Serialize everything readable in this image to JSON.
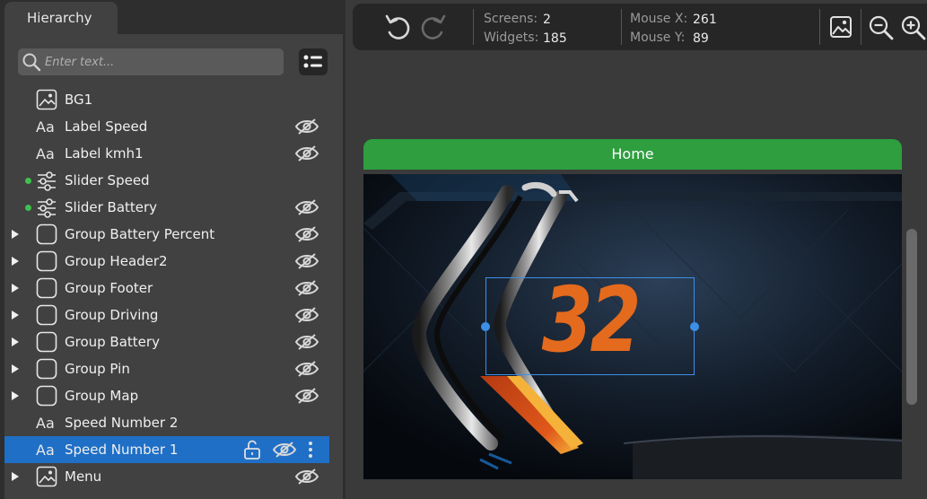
{
  "panel": {
    "tab_label": "Hierarchy",
    "search_placeholder": "Enter text..."
  },
  "tree": [
    {
      "label": "BG1",
      "icon": "image-icon",
      "expandable": false,
      "dot": false,
      "hidden_icon": false
    },
    {
      "label": "Label Speed",
      "icon": "text-icon",
      "expandable": false,
      "dot": false,
      "hidden_icon": true
    },
    {
      "label": "Label kmh1",
      "icon": "text-icon",
      "expandable": false,
      "dot": false,
      "hidden_icon": true
    },
    {
      "label": "Slider Speed",
      "icon": "slider-icon",
      "expandable": false,
      "dot": true,
      "hidden_icon": false
    },
    {
      "label": "Slider Battery",
      "icon": "slider-icon",
      "expandable": false,
      "dot": true,
      "hidden_icon": true
    },
    {
      "label": "Group Battery Percent",
      "icon": "group-icon",
      "expandable": true,
      "dot": false,
      "hidden_icon": true
    },
    {
      "label": "Group Header2",
      "icon": "group-icon",
      "expandable": true,
      "dot": false,
      "hidden_icon": true
    },
    {
      "label": "Group Footer",
      "icon": "group-icon",
      "expandable": true,
      "dot": false,
      "hidden_icon": true
    },
    {
      "label": "Group Driving",
      "icon": "group-icon",
      "expandable": true,
      "dot": false,
      "hidden_icon": true
    },
    {
      "label": "Group Battery",
      "icon": "group-icon",
      "expandable": true,
      "dot": false,
      "hidden_icon": true
    },
    {
      "label": "Group Pin",
      "icon": "group-icon",
      "expandable": true,
      "dot": false,
      "hidden_icon": true
    },
    {
      "label": "Group Map",
      "icon": "group-icon",
      "expandable": true,
      "dot": false,
      "hidden_icon": true
    },
    {
      "label": "Speed Number 2",
      "icon": "text-icon",
      "expandable": false,
      "dot": false,
      "hidden_icon": false
    },
    {
      "label": "Speed Number 1",
      "icon": "text-icon",
      "expandable": false,
      "dot": false,
      "hidden_icon": true,
      "selected": true
    },
    {
      "label": "Menu",
      "icon": "image-icon",
      "expandable": true,
      "dot": false,
      "hidden_icon": true
    }
  ],
  "toolbar": {
    "screens_label": "Screens:",
    "screens_value": "2",
    "widgets_label": "Widgets:",
    "widgets_value": "185",
    "mouse_x_label": "Mouse X:",
    "mouse_x_value": "261",
    "mouse_y_label": "Mouse Y:",
    "mouse_y_value": "89"
  },
  "canvas": {
    "screen_name": "Home",
    "speed_value": "32"
  },
  "colors": {
    "header_green": "#2e9e3f",
    "selection_blue": "#1f6fc6",
    "speed_orange": "#e46a1d",
    "dot_green": "#3fc04f"
  }
}
